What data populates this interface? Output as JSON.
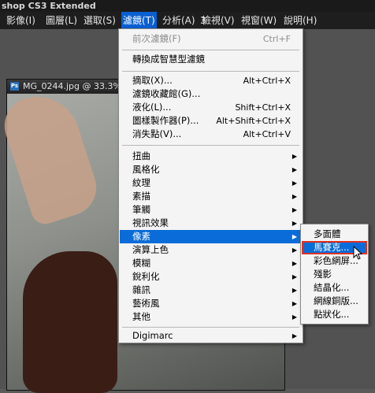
{
  "app_title": "shop CS3 Extended",
  "menubar": [
    "影像(I)",
    "圖層(L)",
    "選取(S)",
    "濾鏡(T)",
    "分析(A)",
    "3",
    "檢視(V)",
    "視窗(W)",
    "說明(H)"
  ],
  "document": {
    "title": "MG_0244.jpg @ 33.3%"
  },
  "filter_menu": {
    "last_filter": {
      "label": "前次濾鏡(F)",
      "shortcut": "Ctrl+F"
    },
    "convert_smart": "轉換成智慧型濾鏡",
    "extract": {
      "label": "摘取(X)...",
      "shortcut": "Alt+Ctrl+X"
    },
    "gallery": {
      "label": "濾鏡收藏館(G)..."
    },
    "liquify": {
      "label": "液化(L)...",
      "shortcut": "Shift+Ctrl+X"
    },
    "pattern_maker": {
      "label": "圖樣製作器(P)...",
      "shortcut": "Alt+Shift+Ctrl+X"
    },
    "vanishing_point": {
      "label": "消失點(V)...",
      "shortcut": "Alt+Ctrl+V"
    },
    "groups": [
      "扭曲",
      "風格化",
      "紋理",
      "素描",
      "筆觸",
      "視訊效果",
      "像素",
      "演算上色",
      "模糊",
      "銳利化",
      "雜訊",
      "藝術風",
      "其他"
    ],
    "digimarc": "Digimarc"
  },
  "pixelate_submenu": [
    "多面體",
    "馬賽克...",
    "彩色網屏...",
    "殘影",
    "結晶化...",
    "網線銅版...",
    "點狀化..."
  ]
}
